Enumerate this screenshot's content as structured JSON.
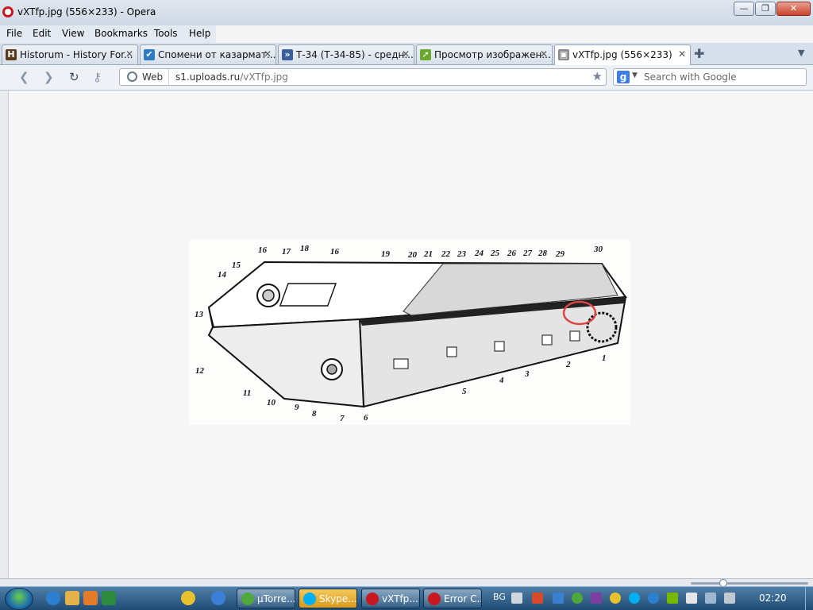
{
  "window": {
    "title": "vXTfp.jpg (556×233) - Opera",
    "min_glyph": "—",
    "max_glyph": "❐",
    "close_glyph": "✕"
  },
  "menu": [
    "File",
    "Edit",
    "View",
    "Bookmarks",
    "Tools",
    "Help"
  ],
  "tabs": [
    {
      "label": "Historum - History For...",
      "favicon": "H",
      "color": "#5a3b1c",
      "active": false
    },
    {
      "label": "Спомени от казармат...",
      "favicon": "✔",
      "color": "#2e7bc4",
      "active": false
    },
    {
      "label": "Т-34 (Т-34-85) - средн...",
      "favicon": "»",
      "color": "#3a5f9a",
      "active": false
    },
    {
      "label": "Просмотр изображен...",
      "favicon": "➚",
      "color": "#6aa82e",
      "active": false
    },
    {
      "label": "vXTfp.jpg (556×233)",
      "favicon": "▣",
      "color": "#8a8a8a",
      "active": true
    }
  ],
  "tab_close_glyph": "✕",
  "tab_new_glyph": "✚",
  "tab_menu_glyph": "▼",
  "nav": {
    "back": "❮",
    "forward": "❯",
    "reload": "↻",
    "key": "⚷"
  },
  "address": {
    "mode_label": "Web",
    "host": "s1.uploads.ru",
    "path": "/vXTfp.jpg",
    "star": "★"
  },
  "search": {
    "engine": "g",
    "placeholder": "Search with Google",
    "dropdown": "▼"
  },
  "diagram_labels": [
    "1",
    "2",
    "3",
    "4",
    "5",
    "6",
    "7",
    "8",
    "9",
    "10",
    "11",
    "12",
    "13",
    "14",
    "15",
    "16",
    "16",
    "17",
    "18",
    "19",
    "20",
    "21",
    "22",
    "23",
    "24",
    "25",
    "26",
    "27",
    "28",
    "29",
    "30"
  ],
  "taskbar": {
    "buttons": [
      {
        "label": "µTorre...",
        "color": "#4fa83a",
        "highlight": false
      },
      {
        "label": "Skype...",
        "color": "#00aff0",
        "highlight": true
      },
      {
        "label": "vXTfp....",
        "color": "#c8171e",
        "highlight": false
      },
      {
        "label": "Error C...",
        "color": "#c8171e",
        "highlight": false
      }
    ],
    "language": "BG",
    "clock": "02:20"
  }
}
